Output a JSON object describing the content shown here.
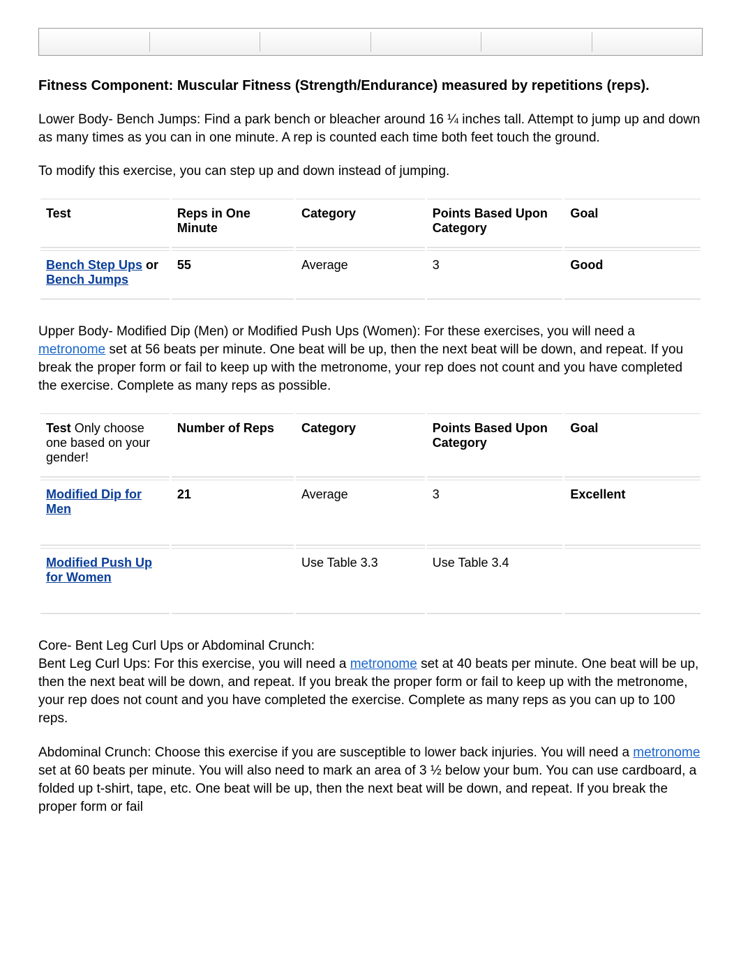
{
  "heading": "Fitness Component: Muscular Fitness (Strength/Endurance) measured by repetitions (reps).",
  "para1": "Lower Body- Bench Jumps: Find a park bench or bleacher around 16 ¼ inches tall. Attempt to jump up and down as many times as you can in one minute. A rep is counted each time both feet touch the ground.",
  "para2": "To modify this exercise, you can step up and down instead of jumping.",
  "table1": {
    "headers": {
      "test": "Test",
      "reps": "Reps in One Minute",
      "category": "Category",
      "points": "Points Based Upon Category",
      "goal": "Goal"
    },
    "row": {
      "test_link1": "Bench Step Ups",
      "test_join": " or ",
      "test_link2": "Bench Jumps",
      "reps": "55",
      "category": "Average",
      "points": "3",
      "goal": "Good"
    }
  },
  "para3_pre": "Upper Body- Modified Dip (Men) or Modified Push Ups (Women): For these exercises, you will need a ",
  "metronome_text": "metronome",
  "para3_post": " set at 56 beats per minute. One beat will be up, then the next beat will be down, and repeat.  If you break the proper form or fail to keep up with the metronome, your rep does not count and you have completed the exercise. Complete as many reps as possible.",
  "table2": {
    "headers": {
      "test_prefix": "Test ",
      "test_note": "Only choose one based on your gender!",
      "reps": "Number of Reps",
      "category": "Category",
      "points": "Points Based Upon Category",
      "goal": "Goal"
    },
    "row1": {
      "test_link": "Modified Dip for Men",
      "reps": "21",
      "category": "Average",
      "points": "3",
      "goal": "Excellent"
    },
    "row2": {
      "test_link": "Modified Push Up for Women",
      "reps": "",
      "category": "Use Table 3.3",
      "points": "Use Table 3.4",
      "goal": ""
    }
  },
  "para4_line1": "Core- Bent Leg Curl Ups or Abdominal Crunch:",
  "para4_pre": "Bent Leg Curl Ups:  For this exercise, you will need a ",
  "para4_post": " set at 40 beats per minute. One beat will be up, then the next beat will be down, and repeat.  If you break the proper form or fail to keep up with the metronome, your rep does not count and you have completed the exercise. Complete as many reps as you can up to 100 reps.",
  "para5_pre": "Abdominal Crunch: Choose this exercise if you are susceptible to lower back injuries. You will need a ",
  "para5_post": " set at 60 beats per minute. You will also need to mark an area of 3 ½ below your bum. You can use cardboard, a folded up t-shirt, tape, etc. One beat will be up, then the next beat will be down, and repeat.  If you break the proper form or fail"
}
